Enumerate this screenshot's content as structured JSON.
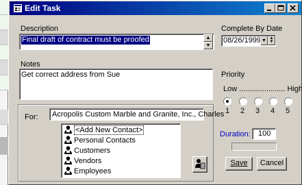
{
  "window": {
    "title": "Edit Task"
  },
  "description": {
    "label": "Description",
    "value": "Final draft of contract must be proofed"
  },
  "complete_by": {
    "label": "Complete By Date",
    "value": "08/26/1999"
  },
  "notes": {
    "label": "Notes",
    "value": "Get correct address from Sue"
  },
  "priority": {
    "label": "Priority",
    "low_high": "Low ...................... High",
    "options": [
      "1",
      "2",
      "3",
      "4",
      "5"
    ],
    "selected": "1"
  },
  "for": {
    "label": "For:",
    "value": "Acropolis Custom Marble and Granite, Inc., Charles",
    "contacts": [
      "<Add New Contact>",
      "Personal Contacts",
      "Customers",
      "Vendors",
      "Employees"
    ],
    "selected_contact": "<Add New Contact>"
  },
  "duration": {
    "label": "Duration:",
    "value": "100"
  },
  "buttons": {
    "save": "Save",
    "cancel": "Cancel"
  },
  "colors": {
    "titlebar": "#000080",
    "duration_label": "#0000c0"
  }
}
